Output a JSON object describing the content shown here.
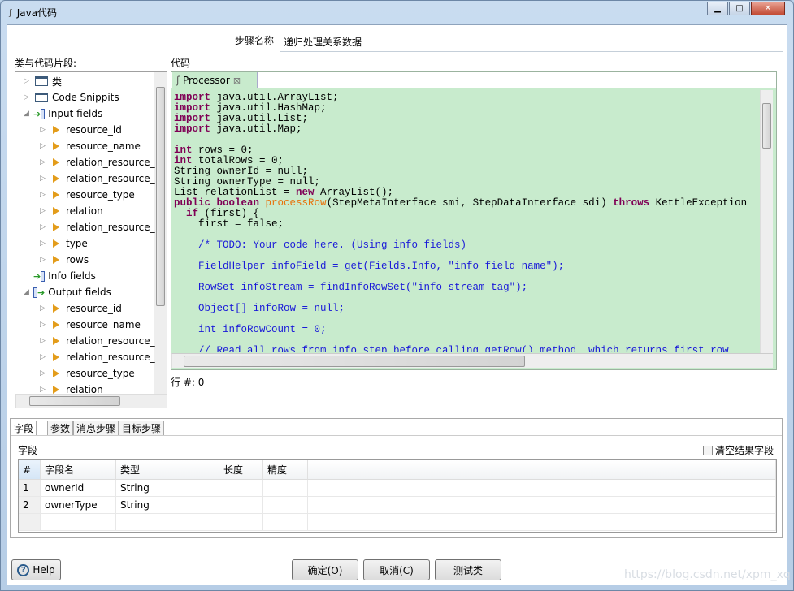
{
  "window": {
    "title": "Java代码",
    "controls": [
      "minimize",
      "maximize",
      "close"
    ]
  },
  "step_name": {
    "label": "步骤名称",
    "value": "递归处理关系数据"
  },
  "tree": {
    "label": "类与代码片段:",
    "items": [
      {
        "label": "类",
        "level": 0,
        "icon": "folder-icon",
        "expanded": false
      },
      {
        "label": "Code Snippits",
        "level": 0,
        "icon": "folder-icon",
        "expanded": false
      },
      {
        "label": "Input fields",
        "level": 0,
        "icon": "input-fields-icon",
        "expanded": true
      },
      {
        "label": "resource_id",
        "level": 1,
        "icon": "field-icon"
      },
      {
        "label": "resource_name",
        "level": 1,
        "icon": "field-icon"
      },
      {
        "label": "relation_resource_",
        "level": 1,
        "icon": "field-icon"
      },
      {
        "label": "relation_resource_",
        "level": 1,
        "icon": "field-icon"
      },
      {
        "label": "resource_type",
        "level": 1,
        "icon": "field-icon"
      },
      {
        "label": "relation",
        "level": 1,
        "icon": "field-icon"
      },
      {
        "label": "relation_resource_",
        "level": 1,
        "icon": "field-icon"
      },
      {
        "label": "type",
        "level": 1,
        "icon": "field-icon"
      },
      {
        "label": "rows",
        "level": 1,
        "icon": "field-icon"
      },
      {
        "label": "Info fields",
        "level": 0,
        "icon": "info-fields-icon",
        "expanded": null
      },
      {
        "label": "Output fields",
        "level": 0,
        "icon": "output-fields-icon",
        "expanded": true
      },
      {
        "label": "resource_id",
        "level": 1,
        "icon": "field-icon"
      },
      {
        "label": "resource_name",
        "level": 1,
        "icon": "field-icon"
      },
      {
        "label": "relation_resource_",
        "level": 1,
        "icon": "field-icon"
      },
      {
        "label": "relation_resource_",
        "level": 1,
        "icon": "field-icon"
      },
      {
        "label": "resource_type",
        "level": 1,
        "icon": "field-icon"
      },
      {
        "label": "relation",
        "level": 1,
        "icon": "field-icon"
      }
    ]
  },
  "code": {
    "label": "代码",
    "tab": "Processor",
    "colors": {
      "background": "#c8ebcd",
      "keyword": "#7f0055",
      "method": "#e8720c",
      "comment": "#1a1ad8"
    },
    "lines": [
      [
        [
          "import",
          "kw"
        ],
        [
          " java.util.ArrayList;",
          "pl"
        ]
      ],
      [
        [
          "import",
          "kw"
        ],
        [
          " java.util.HashMap;",
          "pl"
        ]
      ],
      [
        [
          "import",
          "kw"
        ],
        [
          " java.util.List;",
          "pl"
        ]
      ],
      [
        [
          "import",
          "kw"
        ],
        [
          " java.util.Map;",
          "pl"
        ]
      ],
      [],
      [
        [
          "int",
          "kw"
        ],
        [
          " rows = 0;",
          "pl"
        ]
      ],
      [
        [
          "int",
          "kw"
        ],
        [
          " totalRows = 0;",
          "pl"
        ]
      ],
      [
        [
          "String ownerId = null;",
          "pl"
        ]
      ],
      [
        [
          "String ownerType = null;",
          "pl"
        ]
      ],
      [
        [
          "List relationList = ",
          "pl"
        ],
        [
          "new",
          "kw"
        ],
        [
          " ArrayList();",
          "pl"
        ]
      ],
      [
        [
          "public boolean",
          "kw"
        ],
        [
          " ",
          "pl"
        ],
        [
          "processRow",
          "mt"
        ],
        [
          "(StepMetaInterface smi, StepDataInterface sdi) ",
          "pl"
        ],
        [
          "throws",
          "kw"
        ],
        [
          " KettleException",
          "pl"
        ]
      ],
      [
        [
          "  ",
          "pl"
        ],
        [
          "if",
          "kw"
        ],
        [
          " (first) {",
          "pl"
        ]
      ],
      [
        [
          "    first = false;",
          "pl"
        ]
      ],
      [],
      [
        [
          "    /* TODO: Your code here. (Using info fields)",
          "cm"
        ]
      ],
      [],
      [
        [
          "    FieldHelper infoField = get(Fields.Info, \"info_field_name\");",
          "cm"
        ]
      ],
      [],
      [
        [
          "    RowSet infoStream = findInfoRowSet(\"info_stream_tag\");",
          "cm"
        ]
      ],
      [],
      [
        [
          "    Object[] infoRow = null;",
          "cm"
        ]
      ],
      [],
      [
        [
          "    int infoRowCount = 0;",
          "cm"
        ]
      ],
      [],
      [
        [
          "    // Read all rows from info step before calling getRow() method, which returns first row",
          "cm"
        ]
      ]
    ]
  },
  "row_status": "行 #: 0",
  "bottom_tabs": [
    "字段",
    "参数",
    "消息步骤",
    "目标步骤"
  ],
  "fields": {
    "label": "字段",
    "clear_label": "清空结果字段",
    "clear_checked": false,
    "columns": [
      "#",
      "字段名",
      "类型",
      "长度",
      "精度"
    ],
    "rows": [
      [
        "1",
        "ownerId",
        "String",
        "",
        ""
      ],
      [
        "2",
        "ownerType",
        "String",
        "",
        ""
      ]
    ]
  },
  "buttons": {
    "help": "Help",
    "ok": "确定(O)",
    "cancel": "取消(C)",
    "test": "测试类"
  },
  "watermark": "https://blog.csdn.net/xpm_xq"
}
